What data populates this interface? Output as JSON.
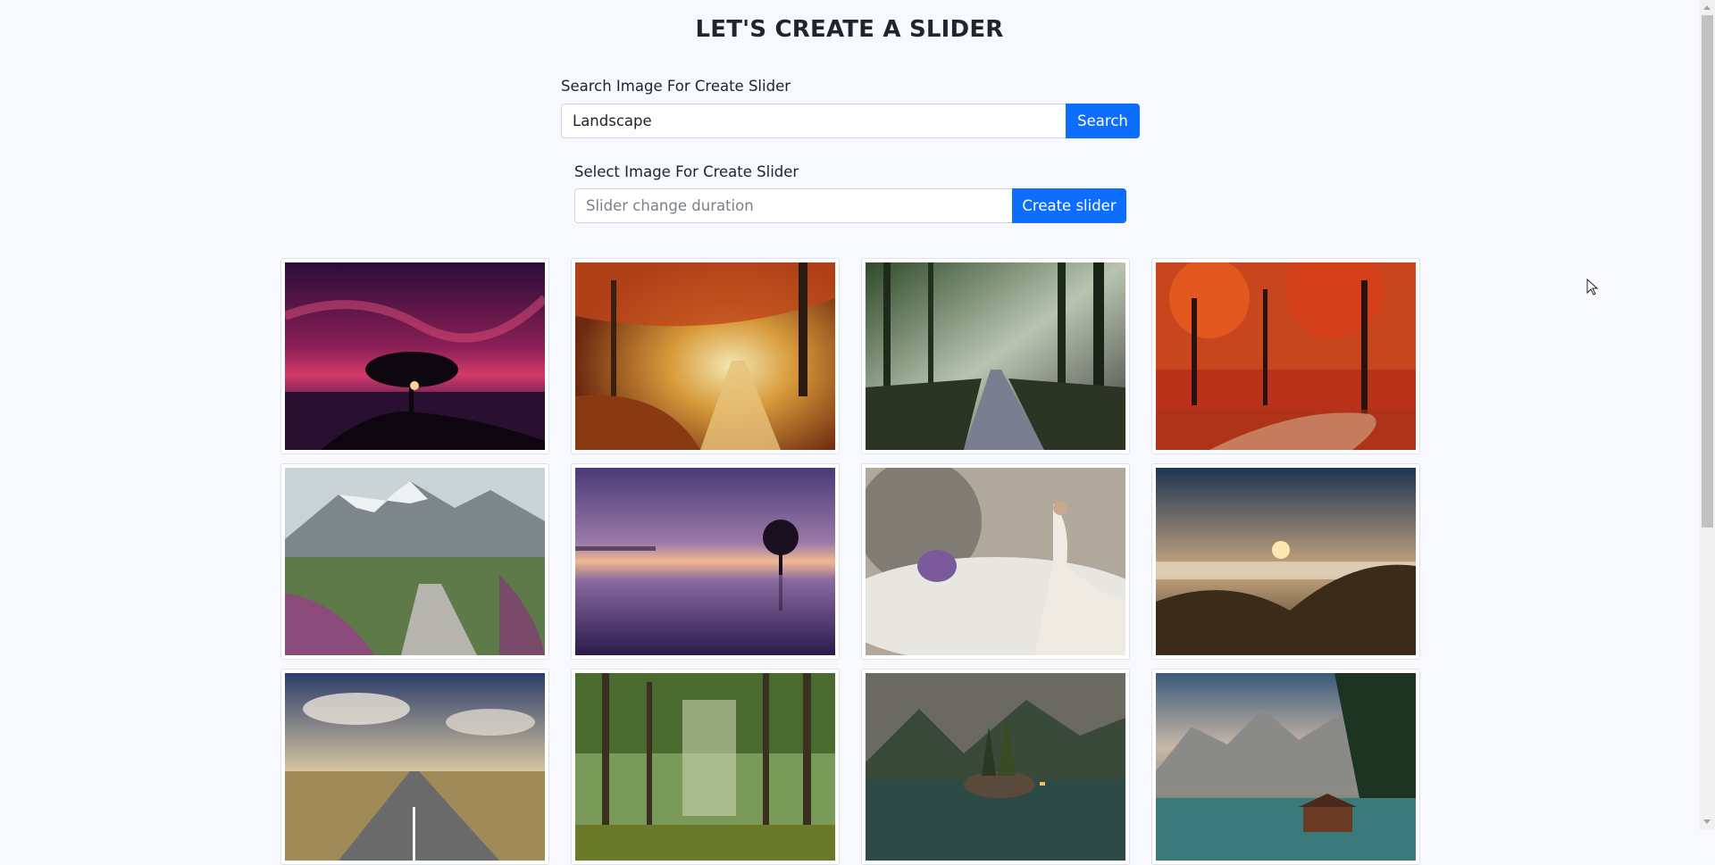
{
  "header": {
    "title": "LET'S CREATE A SLIDER"
  },
  "search": {
    "label": "Search Image For Create Slider",
    "value": "Landscape",
    "button_label": "Search"
  },
  "slider": {
    "label": "Select Image For Create Slider",
    "placeholder": "Slider change duration",
    "value": "",
    "button_label": "Create slider"
  },
  "colors": {
    "accent": "#0d6efd",
    "background": "#f8f9fe"
  },
  "gallery": {
    "images": [
      {
        "name": "tree-sunset-image"
      },
      {
        "name": "autumn-forest-path-image"
      },
      {
        "name": "sunlit-forest-road-image"
      },
      {
        "name": "red-autumn-trees-image"
      },
      {
        "name": "mountain-stone-path-image"
      },
      {
        "name": "lone-tree-lake-image"
      },
      {
        "name": "woman-clouds-castle-image"
      },
      {
        "name": "mountain-sea-of-clouds-image"
      },
      {
        "name": "open-road-sky-image"
      },
      {
        "name": "green-forest-image"
      },
      {
        "name": "mountain-lake-island-image"
      },
      {
        "name": "alpine-lake-cabin-image"
      }
    ]
  }
}
